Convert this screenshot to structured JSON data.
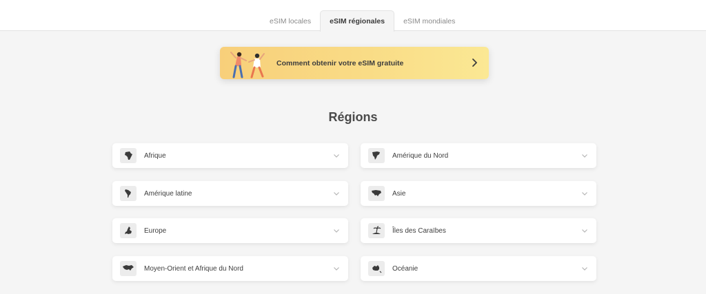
{
  "tabs": [
    {
      "label": "eSIM locales",
      "active": false
    },
    {
      "label": "eSIM régionales",
      "active": true
    },
    {
      "label": "eSIM mondiales",
      "active": false
    }
  ],
  "promo": {
    "text": "Comment obtenir votre eSIM gratuite",
    "icon": "chevron-right-icon"
  },
  "regions_title": "Régions",
  "regions": [
    {
      "label": "Afrique",
      "icon": "africa-map-icon"
    },
    {
      "label": "Amérique du Nord",
      "icon": "north-america-map-icon"
    },
    {
      "label": "Amérique latine",
      "icon": "latin-america-map-icon"
    },
    {
      "label": "Asie",
      "icon": "asia-map-icon"
    },
    {
      "label": "Europe",
      "icon": "europe-map-icon"
    },
    {
      "label": "Îles des Caraïbes",
      "icon": "caribbean-island-icon"
    },
    {
      "label": "Moyen-Orient et Afrique du Nord",
      "icon": "middle-east-map-icon"
    },
    {
      "label": "Océanie",
      "icon": "oceania-map-icon"
    }
  ],
  "colors": {
    "background": "#f5f5f5",
    "promo_start": "#f8cf7a",
    "promo_end": "#fbe894",
    "text": "#3d3d3d"
  }
}
